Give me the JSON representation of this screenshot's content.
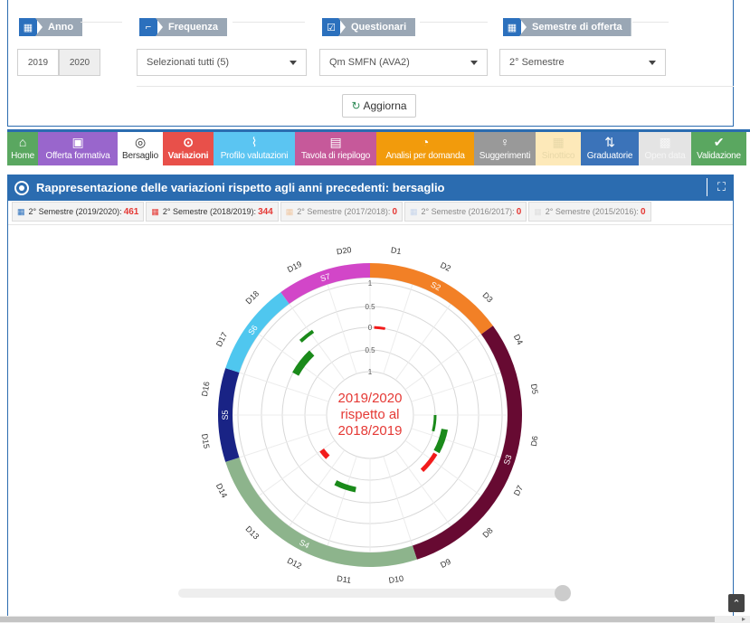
{
  "filters": {
    "anno": {
      "label": "Anno",
      "years": [
        "2019",
        "2020"
      ]
    },
    "frequenza": {
      "label": "Frequenza",
      "value": "Selezionati tutti (5)"
    },
    "questionari": {
      "label": "Questionari",
      "value": "Qm SMFN (AVA2)"
    },
    "semestre": {
      "label": "Semestre di offerta",
      "value": "2° Semestre"
    },
    "refresh_label": "Aggiorna"
  },
  "nav": [
    {
      "label": "Home",
      "icon": "home-icon",
      "glyph": "⌂",
      "color": "#5aa760"
    },
    {
      "label": "Offerta formativa",
      "icon": "teacher-icon",
      "glyph": "▣",
      "color": "#9966cc"
    },
    {
      "label": "Bersaglio",
      "icon": "target-icon",
      "glyph": "◎",
      "color": "#ffffff",
      "text": "#333333"
    },
    {
      "label": "Variazioni",
      "icon": "target-circle-icon",
      "glyph": "⊙",
      "color": "#e8504a",
      "bold": true
    },
    {
      "label": "Profilo valutazioni",
      "icon": "line-chart-icon",
      "glyph": "⌇",
      "color": "#5bc5f2"
    },
    {
      "label": "Tavola di riepilogo",
      "icon": "table-icon",
      "glyph": "▤",
      "color": "#c6599a"
    },
    {
      "label": "Analisi per domanda",
      "icon": "dashboard-icon",
      "glyph": "◔",
      "color": "#f29b0c"
    },
    {
      "label": "Suggerimenti",
      "icon": "lightbulb-icon",
      "glyph": "♀",
      "color": "#999999"
    },
    {
      "label": "Sinottico",
      "icon": "grid-icon",
      "glyph": "▦",
      "color": "#fde9b9",
      "text": "#e8d8a8"
    },
    {
      "label": "Graduatorie",
      "icon": "sort-icon",
      "glyph": "⇅",
      "color": "#3b73b9"
    },
    {
      "label": "Open data",
      "icon": "database-icon",
      "glyph": "▩",
      "color": "#e4e4e4",
      "text": "#f6f6f6"
    },
    {
      "label": "Validazione",
      "icon": "thumbs-up-icon",
      "glyph": "✔",
      "color": "#5aa760"
    }
  ],
  "panel": {
    "title": "Rappresentazione delle variazioni rispetto agli anni precedenti: bersaglio",
    "expand_icon": "expand-icon"
  },
  "semester_tabs": [
    {
      "label": "2° Semestre (2019/2020):",
      "count": "461",
      "active": true
    },
    {
      "label": "2° Semestre (2018/2019):",
      "count": "344",
      "active": true
    },
    {
      "label": "2° Semestre (2017/2018):",
      "count": "0",
      "active": false
    },
    {
      "label": "2° Semestre (2016/2017):",
      "count": "0",
      "active": false
    },
    {
      "label": "2° Semestre (2015/2016):",
      "count": "0",
      "active": false
    }
  ],
  "chart_data": {
    "type": "radial",
    "center_label": [
      "2019/2020",
      "rispetto al",
      "2018/2019"
    ],
    "ring_labels": [
      "1",
      "0.5",
      "0",
      "0.5",
      "1"
    ],
    "questions": [
      "D1",
      "D2",
      "D3",
      "D4",
      "D5",
      "D6",
      "D7",
      "D8",
      "D9",
      "D10",
      "D11",
      "D12",
      "D13",
      "D14",
      "D15",
      "D16",
      "D17",
      "D18",
      "D19",
      "D20"
    ],
    "sections": [
      {
        "name": "S2",
        "start": 0,
        "end": 3,
        "color": "#f28026"
      },
      {
        "name": "S3",
        "start": 3,
        "end": 9,
        "color": "#670a32"
      },
      {
        "name": "S4",
        "start": 9,
        "end": 14,
        "color": "#8db48c"
      },
      {
        "name": "S5",
        "start": 14,
        "end": 16,
        "color": "#192385"
      },
      {
        "name": "S6",
        "start": 16,
        "end": 18,
        "color": "#4fc7ef"
      },
      {
        "name": "S7",
        "start": 18,
        "end": 20,
        "color": "#d246c8"
      }
    ],
    "variations": [
      {
        "question": "D1",
        "value": -0.05
      },
      {
        "question": "D5",
        "value": 0.06
      },
      {
        "question": "D6",
        "value": 0.18
      },
      {
        "question": "D6b",
        "value": -0.12
      },
      {
        "question": "D9",
        "value": 0.15
      },
      {
        "question": "D11",
        "value": -0.15
      },
      {
        "question": "D17",
        "value": 0.2
      },
      {
        "question": "D17b",
        "value": 0.1
      }
    ],
    "colors": {
      "positive": "#1a8a1a",
      "negative": "#f21b1b"
    }
  }
}
